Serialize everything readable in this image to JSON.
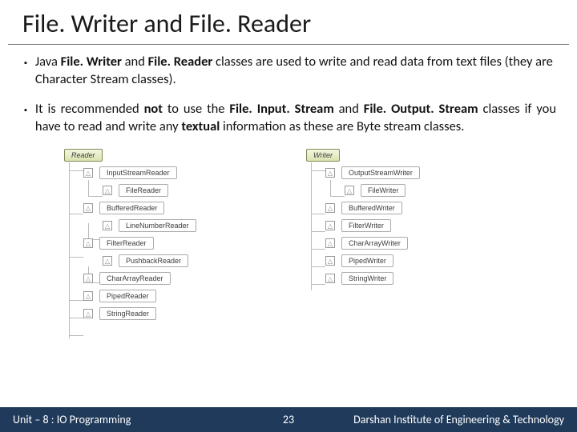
{
  "title": "File. Writer and File. Reader",
  "bullets": [
    {
      "pre": "Java ",
      "bold1": "File. Writer",
      "mid": " and ",
      "bold2": "File. Reader",
      "post": " classes are used to write and read data from text files (they are Character Stream classes)."
    },
    {
      "pre": "It is recommended ",
      "bold1": "not",
      "mid1": " to use the ",
      "bold2": "File. Input. Stream",
      "mid2": " and ",
      "bold3": "File. Output. Stream",
      "mid3": " classes if you have to read and write any ",
      "bold4": "textual",
      "post": " information as these are Byte stream classes."
    }
  ],
  "diagram": {
    "left": {
      "root": "Reader",
      "children": [
        {
          "name": "InputStreamReader",
          "children": [
            "FileReader"
          ]
        },
        {
          "name": "BufferedReader",
          "children": [
            "LineNumberReader"
          ]
        },
        {
          "name": "FilterReader",
          "children": [
            "PushbackReader"
          ]
        },
        {
          "name": "CharArrayReader"
        },
        {
          "name": "PipedReader"
        },
        {
          "name": "StringReader"
        }
      ]
    },
    "right": {
      "root": "Writer",
      "children": [
        {
          "name": "OutputStreamWriter",
          "children": [
            "FileWriter"
          ]
        },
        {
          "name": "BufferedWriter"
        },
        {
          "name": "FilterWriter"
        },
        {
          "name": "CharArrayWriter"
        },
        {
          "name": "PipedWriter"
        },
        {
          "name": "StringWriter"
        }
      ]
    }
  },
  "footer": {
    "unit": "Unit – 8 : IO Programming",
    "page": "23",
    "org": "Darshan Institute of Engineering & Technology"
  }
}
